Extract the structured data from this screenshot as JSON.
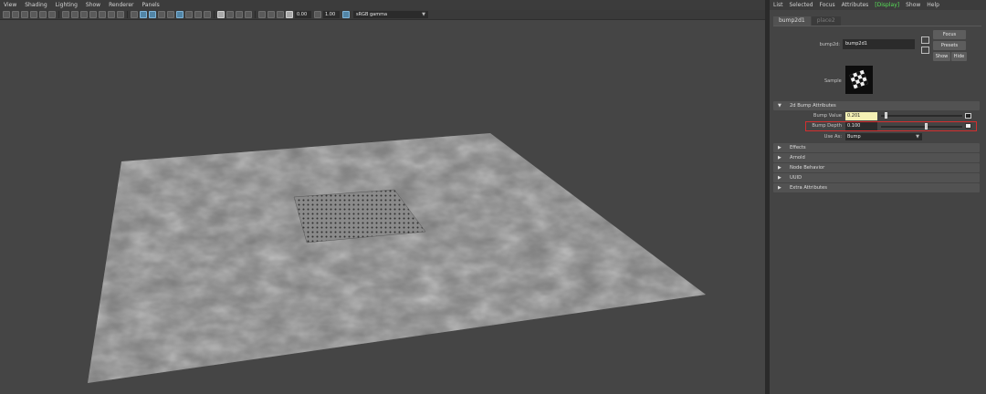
{
  "viewport": {
    "menu": [
      "View",
      "Shading",
      "Lighting",
      "Show",
      "Renderer",
      "Panels"
    ],
    "toolbar": {
      "exposure_value": "0.00",
      "gamma_value": "1.00",
      "color_space": "sRGB gamma"
    }
  },
  "attribute_editor": {
    "menu": [
      "List",
      "Selected",
      "Focus",
      "Attributes",
      "Display",
      "Show",
      "Help"
    ],
    "active_menu": "Display",
    "tabs": [
      "bump2d1",
      "place2"
    ],
    "node_label": "bump2d:",
    "node_name": "bump2d1",
    "buttons": {
      "focus": "Focus",
      "presets": "Presets",
      "show": "Show",
      "hide": "Hide"
    },
    "sample_label": "Sample",
    "section_main": "2d Bump Attributes",
    "bump_value_label": "Bump Value",
    "bump_value": "0.201",
    "bump_value_slider": 0.05,
    "bump_depth_label": "Bump Depth",
    "bump_depth": "0.100",
    "bump_depth_slider": 0.54,
    "use_as_label": "Use As:",
    "use_as_value": "Bump",
    "collapsed_sections": [
      "Effects",
      "Arnold",
      "Node Behavior",
      "UUID",
      "Extra Attributes"
    ]
  }
}
